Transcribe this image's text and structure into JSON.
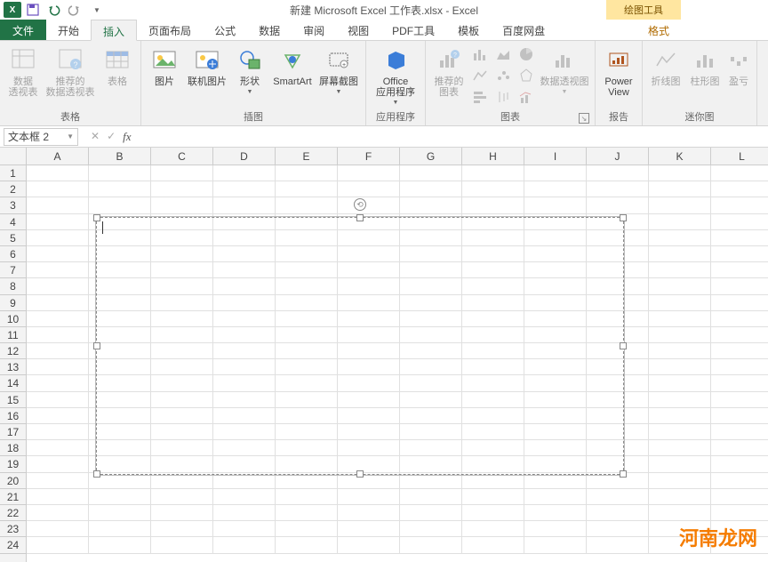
{
  "titlebar": {
    "title": "新建 Microsoft Excel 工作表.xlsx - Excel",
    "logo": "X",
    "context_tool": "绘图工具"
  },
  "tabs": {
    "file": "文件",
    "items": [
      "开始",
      "插入",
      "页面布局",
      "公式",
      "数据",
      "审阅",
      "视图",
      "PDF工具",
      "模板",
      "百度网盘"
    ],
    "active_index": 1,
    "context": "格式"
  },
  "ribbon": {
    "groups": {
      "tables": {
        "label": "表格",
        "pivot": "数据\n透视表",
        "recommended": "推荐的\n数据透视表",
        "table": "表格"
      },
      "illustrations": {
        "label": "插图",
        "picture": "图片",
        "online_pic": "联机图片",
        "shapes": "形状",
        "smartart": "SmartArt",
        "screenshot": "屏幕截图"
      },
      "apps": {
        "label": "应用程序",
        "office_apps": "Office\n应用程序"
      },
      "charts": {
        "label": "图表",
        "recommended": "推荐的\n图表",
        "pivotchart": "数据透视图"
      },
      "reports": {
        "label": "报告",
        "powerview": "Power\nView"
      },
      "sparklines": {
        "label": "迷你图",
        "line": "折线图",
        "column": "柱形图",
        "winloss": "盈亏"
      }
    }
  },
  "formula_bar": {
    "name_box": "文本框 2",
    "cancel": "✕",
    "confirm": "✓",
    "fx": "fx"
  },
  "grid": {
    "columns": [
      "A",
      "B",
      "C",
      "D",
      "E",
      "F",
      "G",
      "H",
      "I",
      "J",
      "K",
      "L"
    ],
    "row_count": 24
  },
  "watermark": "河南龙网"
}
